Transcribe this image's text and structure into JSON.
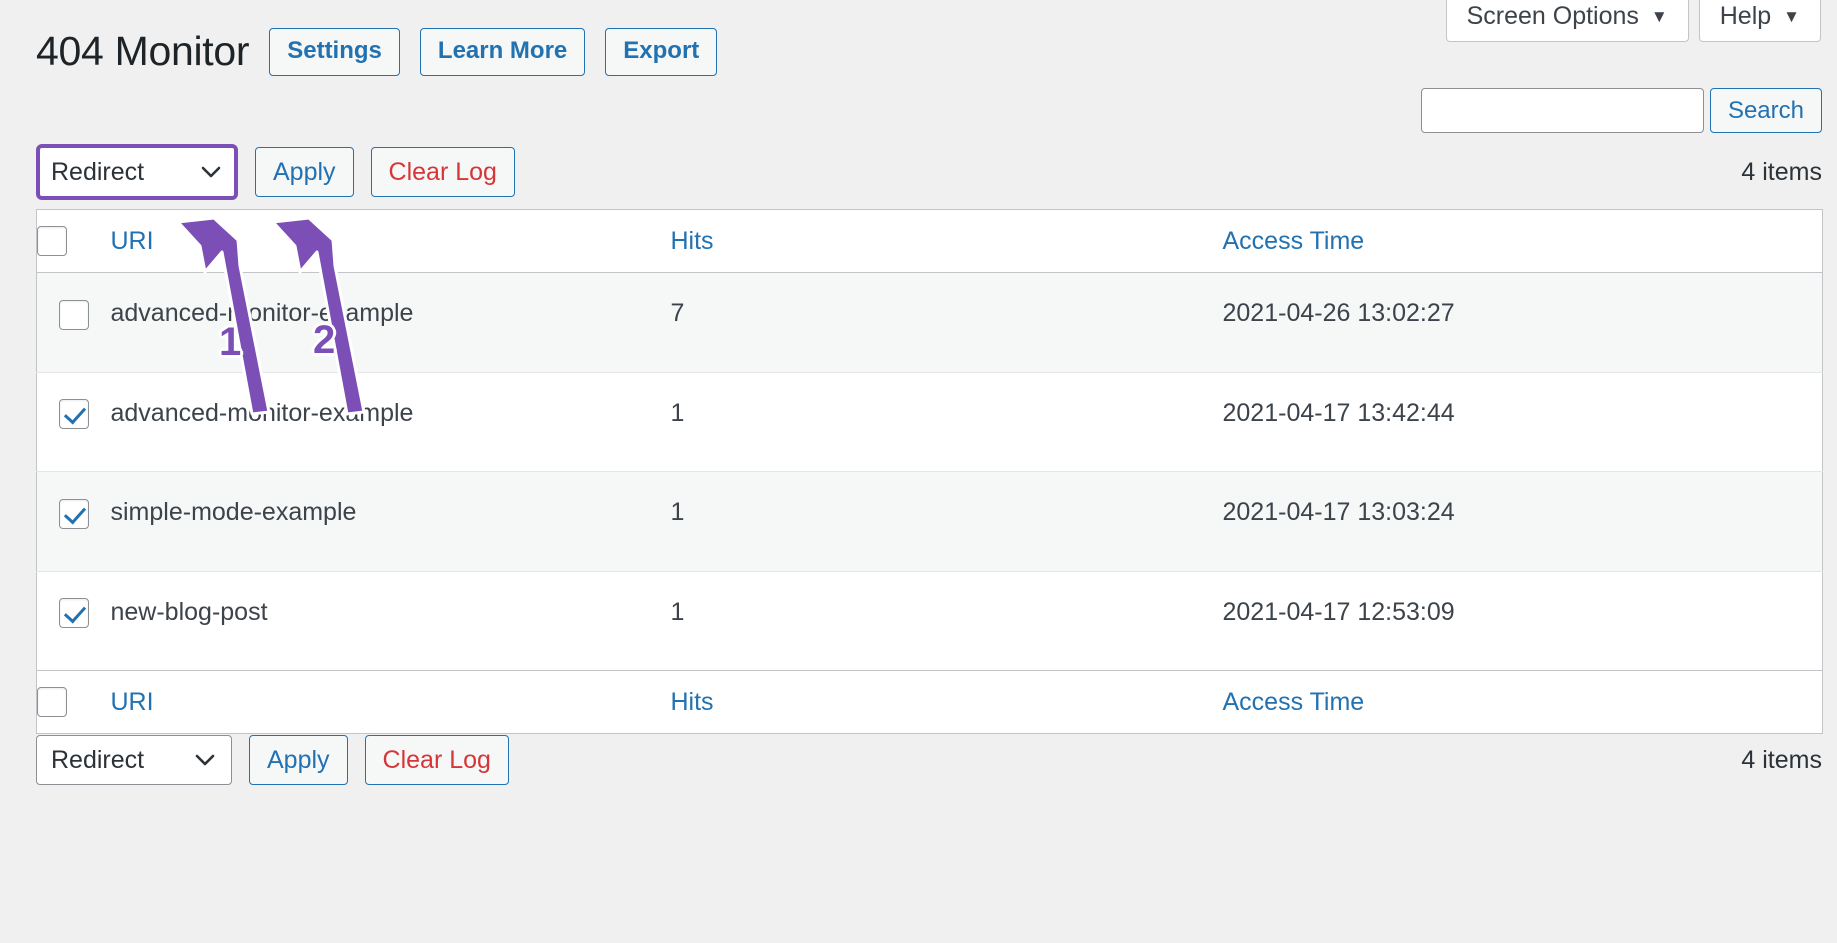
{
  "screen_meta": {
    "screen_options_label": "Screen Options",
    "help_label": "Help",
    "caret": "▼"
  },
  "header": {
    "title": "404 Monitor",
    "actions": [
      {
        "label": "Settings",
        "name": "settings-button"
      },
      {
        "label": "Learn More",
        "name": "learn-more-button"
      },
      {
        "label": "Export",
        "name": "export-button"
      }
    ]
  },
  "search": {
    "value": "",
    "placeholder": "",
    "submit_label": "Search"
  },
  "tablenav_top": {
    "bulk_action_selected": "Redirect",
    "bulk_action_options": [
      "Redirect"
    ],
    "apply_label": "Apply",
    "clear_log_label": "Clear Log",
    "displaying_num": "4 items"
  },
  "tablenav_bottom": {
    "bulk_action_selected": "Redirect",
    "bulk_action_options": [
      "Redirect"
    ],
    "apply_label": "Apply",
    "clear_log_label": "Clear Log",
    "displaying_num": "4 items"
  },
  "table": {
    "columns": [
      {
        "key": "uri",
        "label": "URI"
      },
      {
        "key": "hits",
        "label": "Hits"
      },
      {
        "key": "access_time",
        "label": "Access Time"
      }
    ],
    "rows": [
      {
        "selected": false,
        "uri": "advanced-monitor-example",
        "hits": "7",
        "access_time": "2021-04-26 13:02:27"
      },
      {
        "selected": true,
        "uri": "advanced-monitor-example",
        "hits": "1",
        "access_time": "2021-04-17 13:42:44"
      },
      {
        "selected": true,
        "uri": "simple-mode-example",
        "hits": "1",
        "access_time": "2021-04-17 13:03:24"
      },
      {
        "selected": true,
        "uri": "new-blog-post",
        "hits": "1",
        "access_time": "2021-04-17 12:53:09"
      }
    ]
  },
  "annotations": {
    "color": "#7b4fb5",
    "markers": [
      {
        "number": "1",
        "target": "bulk-action-select"
      },
      {
        "number": "2",
        "target": "apply-button"
      }
    ]
  },
  "colors": {
    "accent_blue": "#2271b1",
    "danger_red": "#d63638",
    "annotation_purple": "#7b4fb5",
    "page_bg": "#f0f0f1"
  }
}
